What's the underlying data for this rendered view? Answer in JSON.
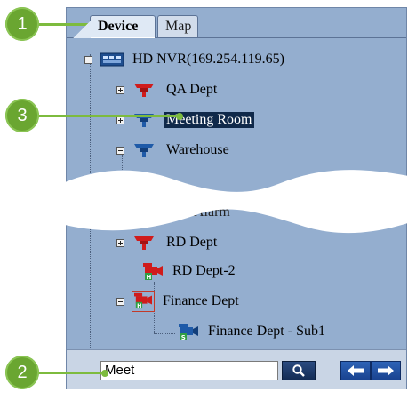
{
  "tabs": [
    {
      "label": "Device",
      "active": true
    },
    {
      "label": "Map",
      "active": false
    }
  ],
  "tree": {
    "root": {
      "label": "HD NVR(169.254.119.65)",
      "icon": "nvr-icon",
      "expanded": true
    },
    "nodes": [
      {
        "label": "QA Dept",
        "icon": "group-red-icon",
        "expander": "plus"
      },
      {
        "label": "Meeting Room",
        "icon": "group-blue-icon",
        "expander": "plus",
        "selected": true
      },
      {
        "label": "Warehouse",
        "icon": "group-blue-icon",
        "expander": "minus"
      },
      {
        "label": "Alarm",
        "icon": "alarm-icon",
        "partial": true
      },
      {
        "label": "RD Dept",
        "icon": "group-red-icon",
        "expander": "plus"
      },
      {
        "label": "RD Dept-2",
        "icon": "camera-h-red-icon"
      },
      {
        "label": "Finance Dept",
        "icon": "camera-h-red-icon",
        "expander": "minus"
      },
      {
        "label": "Finance Dept - Sub1",
        "icon": "camera-s-blue-icon"
      }
    ]
  },
  "search": {
    "value": "Meet",
    "button_icon": "search-icon"
  },
  "navigation": {
    "prev_icon": "arrow-left-icon",
    "next_icon": "arrow-right-icon"
  },
  "callouts": [
    "1",
    "2",
    "3"
  ],
  "colors": {
    "panel": "#94aecf",
    "selected": "#10294a",
    "callout": "#6aa631",
    "red_group": "#d01b1b",
    "blue_group": "#1e5aa8"
  }
}
